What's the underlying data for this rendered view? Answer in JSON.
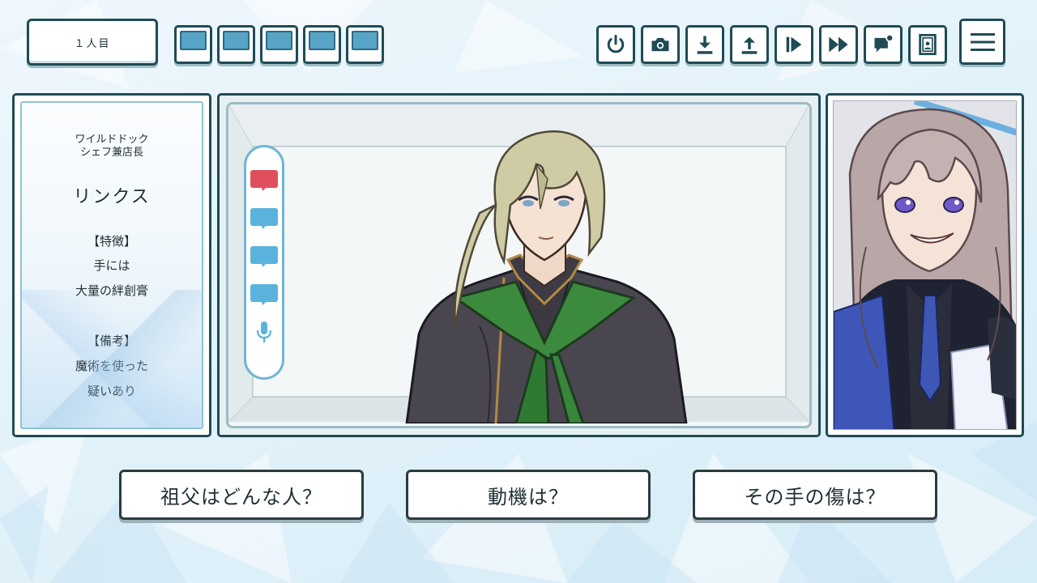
{
  "header": {
    "person_counter": "１人目",
    "slots": [
      "slot-1",
      "slot-2",
      "slot-3",
      "slot-4",
      "slot-5"
    ]
  },
  "toolbar": {
    "icons": [
      "power-icon",
      "camera-icon",
      "download-icon",
      "upload-icon",
      "play-step-icon",
      "fast-forward-icon",
      "chat-notification-icon",
      "portrait-card-icon",
      "menu-icon"
    ]
  },
  "profile": {
    "org_line1": "ワイルドドック",
    "org_line2": "シェフ兼店長",
    "name": "リンクス",
    "feature_heading": "【特徴】",
    "feature_line1": "手には",
    "feature_line2": "大量の絆創膏",
    "note_heading": "【備考】",
    "note_line1": "魔術を使った",
    "note_line2": "疑いあり"
  },
  "stage": {
    "bubbles": [
      {
        "name": "red-speech-bubble",
        "color": "#e0505c"
      },
      {
        "name": "blue-speech-bubble",
        "color": "#5ab3dc"
      },
      {
        "name": "blue-speech-bubble",
        "color": "#5ab3dc"
      },
      {
        "name": "blue-speech-bubble",
        "color": "#5ab3dc"
      }
    ],
    "mic": "microphone-icon"
  },
  "choices": [
    {
      "label": "祖父はどんな人？"
    },
    {
      "label": "動機は？"
    },
    {
      "label": "その手の傷は？"
    }
  ],
  "colors": {
    "frame": "#1f4b55",
    "slot_blue": "#58a4c7",
    "pill_border": "#6fb6d4",
    "accent_red": "#e0505c"
  }
}
